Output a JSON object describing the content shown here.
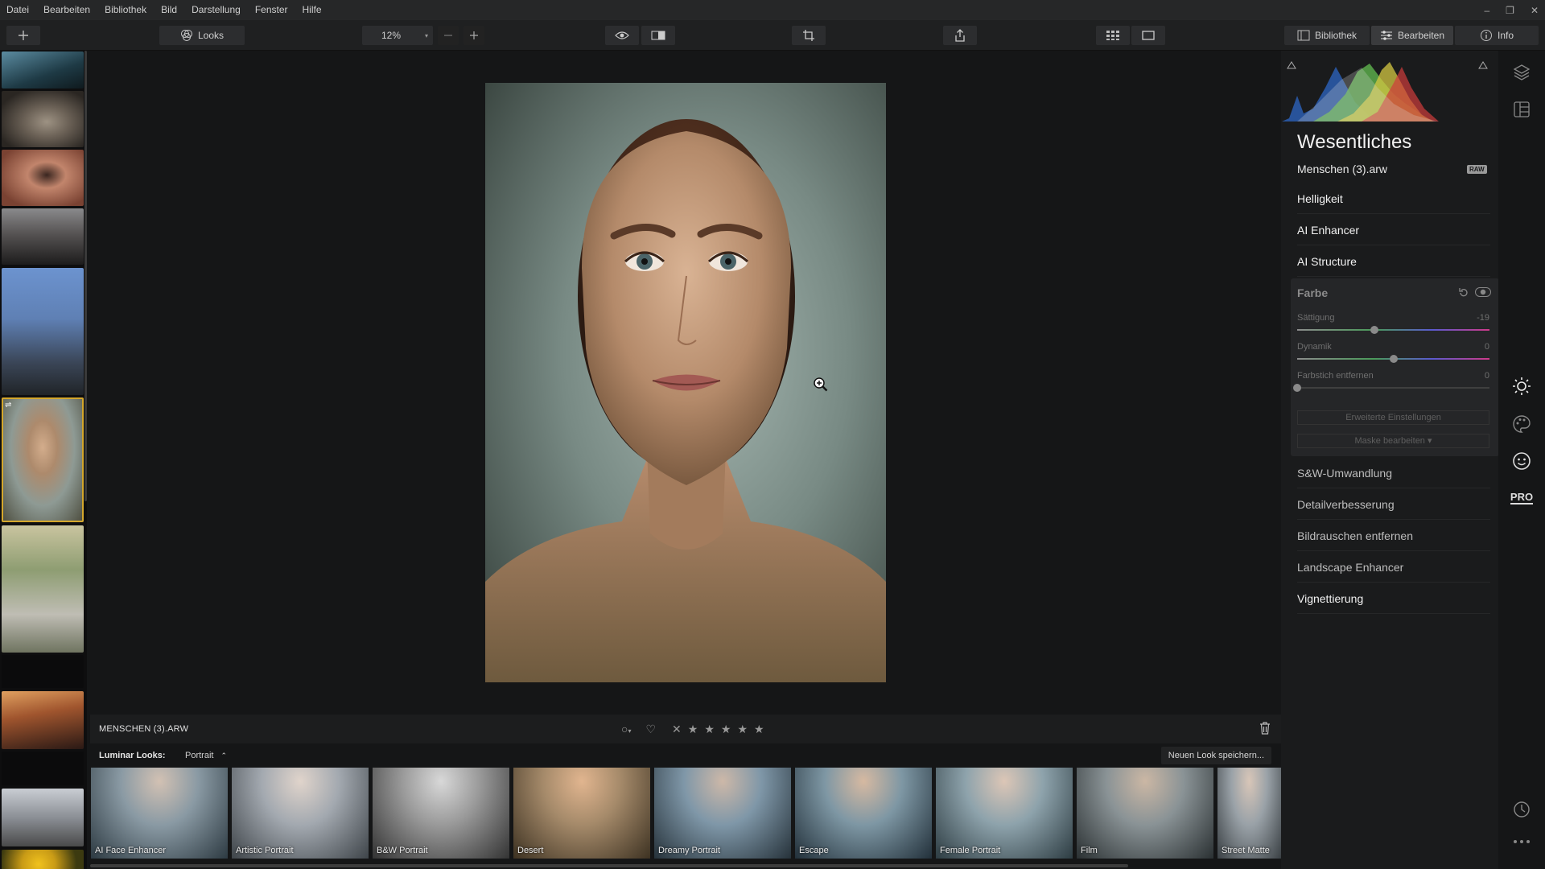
{
  "menu": [
    "Datei",
    "Bearbeiten",
    "Bibliothek",
    "Bild",
    "Darstellung",
    "Fenster",
    "Hilfe"
  ],
  "toolbar": {
    "looks_label": "Looks",
    "zoom": "12%",
    "bibliothek_label": "Bibliothek",
    "bearbeiten_label": "Bearbeiten",
    "info_label": "Info"
  },
  "filmstrip": {
    "thumbs": [
      {
        "name": "thumb-landscape-lake",
        "c1": "#3e6f84",
        "c2": "#1c3038"
      },
      {
        "name": "thumb-cat",
        "c1": "#8a7f72",
        "c2": "#3e3a35"
      },
      {
        "name": "thumb-eye",
        "c1": "#b0735d",
        "c2": "#5c2e25"
      },
      {
        "name": "thumb-woman-city",
        "c1": "#6f6c6a",
        "c2": "#2b2929"
      },
      {
        "name": "thumb-new-york",
        "c1": "#5f86c4",
        "c2": "#2a3443"
      },
      {
        "name": "thumb-portrait-selected",
        "c1": "#9aa69e",
        "c2": "#4c4a3c"
      },
      {
        "name": "thumb-woman-field",
        "c1": "#b5b09b",
        "c2": "#56604a"
      },
      {
        "name": "thumb-dark",
        "c1": "#0b0b0c",
        "c2": "#0b0b0c"
      },
      {
        "name": "thumb-sunset-street",
        "c1": "#d48a44",
        "c2": "#2b1a17"
      },
      {
        "name": "thumb-cyclist",
        "c1": "#a9aeb5",
        "c2": "#4a4a4a"
      },
      {
        "name": "thumb-sunflower",
        "c1": "#e0b61c",
        "c2": "#3c3a10"
      }
    ]
  },
  "infobar": {
    "filename": "MENSCHEN (3).ARW"
  },
  "looks": {
    "label": "Luminar Looks:",
    "category": "Portrait",
    "save_label": "Neuen Look speichern...",
    "items": [
      {
        "name": "AI Face Enhancer",
        "tint": "#8a9aa4"
      },
      {
        "name": "Artistic Portrait",
        "tint": "#a3a9b0"
      },
      {
        "name": "B&W Portrait",
        "tint": "#9a9a9a"
      },
      {
        "name": "Desert",
        "tint": "#a58a6a"
      },
      {
        "name": "Dreamy Portrait",
        "tint": "#7f97a8"
      },
      {
        "name": "Escape",
        "tint": "#7e97a4"
      },
      {
        "name": "Female Portrait",
        "tint": "#8ea3ac"
      },
      {
        "name": "Film",
        "tint": "#8a9396"
      },
      {
        "name": "Street Matte",
        "tint": "#9aa2a8"
      }
    ]
  },
  "panel": {
    "title": "Wesentliches",
    "filename": "Menschen (3).arw",
    "raw_badge": "RAW",
    "sections_top": [
      "Helligkeit",
      "AI Enhancer",
      "AI Structure"
    ],
    "farbe": {
      "title": "Farbe",
      "sliders": [
        {
          "label": "Sättigung",
          "value": "-19",
          "fraction": 0.4
        },
        {
          "label": "Dynamik",
          "value": "0",
          "fraction": 0.5
        },
        {
          "label": "Farbstich entfernen",
          "value": "0",
          "fraction": 0.0
        }
      ],
      "advanced_label": "Erweiterte Einstellungen",
      "mask_label": "Maske bearbeiten ▾"
    },
    "sections_bottom": [
      {
        "label": "S&W-Umwandlung",
        "bright": false
      },
      {
        "label": "Detailverbesserung",
        "bright": false
      },
      {
        "label": "Bildrauschen entfernen",
        "bright": false
      },
      {
        "label": "Landscape Enhancer",
        "bright": false
      },
      {
        "label": "Vignettierung",
        "bright": true
      }
    ]
  },
  "iconcol": {
    "pro_label": "PRO"
  },
  "colors": {
    "accent_selected": "#d4a72c",
    "panel_bg": "#1a1b1c"
  }
}
